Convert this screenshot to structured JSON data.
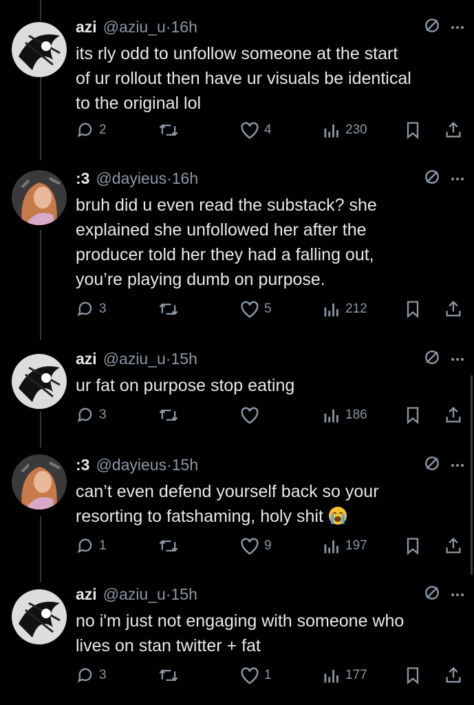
{
  "colors": {
    "background": "#000000",
    "text": "#e7e9ea",
    "muted": "#8b98a5",
    "thread_line": "#333639"
  },
  "tweets": [
    {
      "name": "azi",
      "handle": "@aziu_u",
      "sep": " · ",
      "time": "16h",
      "text": "its rly odd to unfollow someone at the start\nof ur rollout then have ur visuals be identical\nto the original lol",
      "replies": "2",
      "retweets": "",
      "likes": "4",
      "views": "230",
      "avatar_icon": "monochrome-art-avatar"
    },
    {
      "name": ":3",
      "handle": "@dayieus",
      "sep": " · ",
      "time": "16h",
      "text": "bruh did u even read the substack? she\nexplained she unfollowed her after the\nproducer told her they had a falling out,\nyou’re playing dumb on purpose.",
      "replies": "3",
      "retweets": "",
      "likes": "5",
      "views": "212",
      "avatar_icon": "photo-avatar"
    },
    {
      "name": "azi",
      "handle": "@aziu_u",
      "sep": " · ",
      "time": "15h",
      "text": "ur fat on purpose stop eating",
      "replies": "3",
      "retweets": "",
      "likes": "",
      "views": "186",
      "avatar_icon": "monochrome-art-avatar"
    },
    {
      "name": ":3",
      "handle": "@dayieus",
      "sep": " · ",
      "time": "15h",
      "text": "can’t even defend yourself back so your\nresorting to fatshaming, holy shit",
      "emoji_icon": "loudly-crying-face-emoji",
      "replies": "1",
      "retweets": "",
      "likes": "9",
      "views": "197",
      "avatar_icon": "photo-avatar"
    },
    {
      "name": "azi",
      "handle": "@aziu_u",
      "sep": " · ",
      "time": "15h",
      "text": "no i'm just not engaging with someone who\nlives on stan twitter + fat",
      "replies": "3",
      "retweets": "",
      "likes": "1",
      "views": "177",
      "avatar_icon": "monochrome-art-avatar"
    }
  ]
}
